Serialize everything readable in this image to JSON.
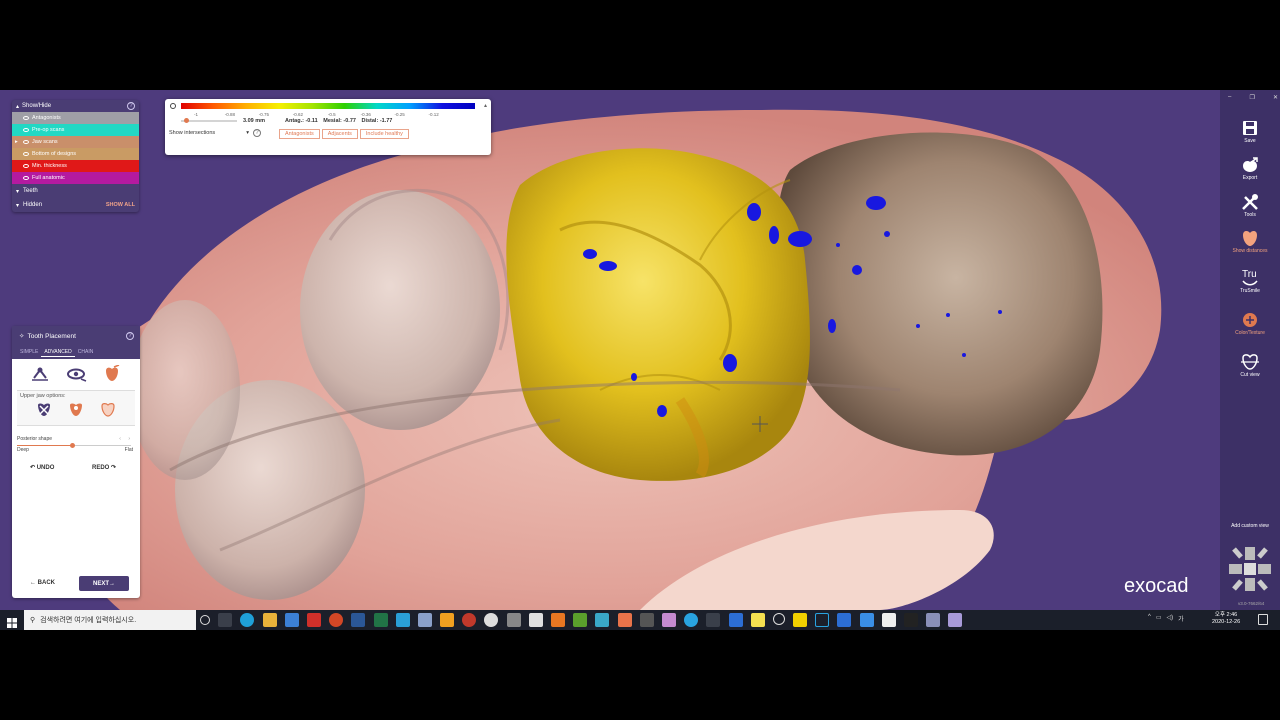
{
  "show_hide": {
    "title": "Show/Hide",
    "layers": [
      {
        "label": "Antagonists",
        "color": "#9f9fa6"
      },
      {
        "label": "Pre-op scans",
        "color": "#22d8c4"
      },
      {
        "label": "Jaw scans",
        "color": "#c98f6a"
      },
      {
        "label": "Bottom of designs",
        "color": "#c99b64"
      },
      {
        "label": "Min. thickness",
        "color": "#e01818"
      },
      {
        "label": "Full anatomic",
        "color": "#b41aa0"
      }
    ],
    "teeth_label": "Teeth",
    "hidden_label": "Hidden",
    "show_all_label": "SHOW ALL"
  },
  "distance_scale": {
    "ticks": [
      "-1",
      "-0.88",
      "-0.75",
      "-0.62",
      "-0.5",
      "-0.36",
      "-0.25",
      "-0.12"
    ],
    "slider_fraction": 0.05,
    "thickness": "3.09 mm",
    "antag": "Antag.: -0.11",
    "mesial": "Mesial: -0.77",
    "distal": "Distal: -1.77",
    "intersections_label": "Show intersections",
    "buttons": [
      "Antagonists",
      "Adjacents",
      "Include healthy"
    ]
  },
  "tooth_placement": {
    "title": "Tooth Placement",
    "tabs": [
      "SIMPLE",
      "ADVANCED",
      "CHAIN"
    ],
    "active_tab": "ADVANCED",
    "upper_jaw_label": "Upper jaw options:",
    "posterior_shape_label": "Posterior shape",
    "posterior_shape_value": 0.49,
    "deep_label": "Deep",
    "flat_label": "Flat",
    "undo_label": "UNDO",
    "redo_label": "REDO",
    "back_label": "BACK",
    "next_label": "NEXT"
  },
  "toolbar": {
    "items": [
      {
        "label": "Save",
        "icon": "save-icon",
        "accent": false
      },
      {
        "label": "Export",
        "icon": "export-icon",
        "accent": false
      },
      {
        "label": "Tools",
        "icon": "tools-icon",
        "accent": false
      },
      {
        "label": "Show distances",
        "icon": "show-distances-icon",
        "accent": true
      },
      {
        "label": "TruSmile",
        "icon": "trusmile-icon",
        "accent": false
      },
      {
        "label": "Color/Texture",
        "icon": "color-texture-icon",
        "accent": true
      },
      {
        "label": "Cut view",
        "icon": "cut-view-icon",
        "accent": false
      }
    ],
    "add_custom_view": "Add custom view",
    "version": "v3.0-7662/64"
  },
  "brand": {
    "logo": "exocad"
  },
  "taskbar": {
    "search_placeholder": "검색하려면 여기에 입력하십시오.",
    "time": "오후 2:46",
    "date": "2020-12-26"
  },
  "colors": {
    "background": "#4e3b7d",
    "panel": "#4a3d74",
    "accent": "#e0794f",
    "crown": "#e4c21a"
  }
}
